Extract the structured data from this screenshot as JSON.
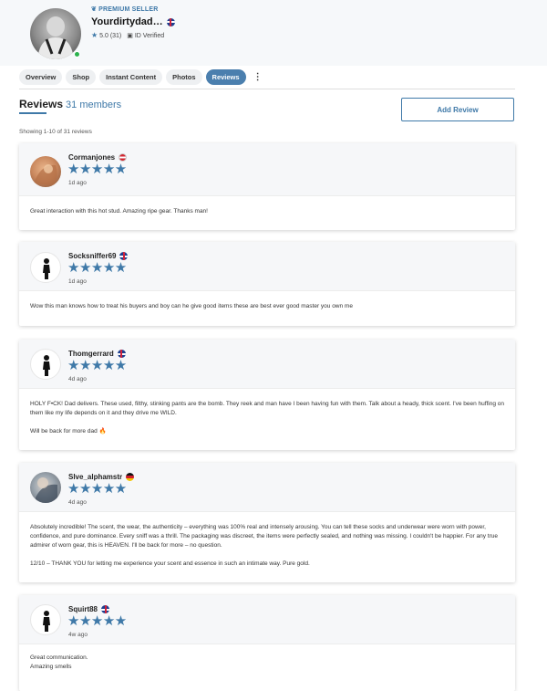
{
  "seller": {
    "badge": "PREMIUM SELLER",
    "name": "Yourdirtydad…",
    "rating": "5.0",
    "rating_count": "(31)",
    "verified": "ID Verified",
    "flag": "uk"
  },
  "tabs": [
    {
      "label": "Overview",
      "active": false
    },
    {
      "label": "Shop",
      "active": false
    },
    {
      "label": "Instant Content",
      "active": false
    },
    {
      "label": "Photos",
      "active": false
    },
    {
      "label": "Reviews",
      "active": true
    }
  ],
  "more_icon": "⋮",
  "reviews_header": {
    "title": "Reviews",
    "count": "31 members",
    "add_button": "Add Review",
    "showing": "Showing 1-10 of 31 reviews"
  },
  "reviews": [
    {
      "name": "Cormanjones",
      "flag": "at",
      "avatar": "photo",
      "stars": "★★★★★",
      "ago": "1d ago",
      "paragraphs": [
        "Great interaction with this hot stud. Amazing ripe gear. Thanks man!"
      ]
    },
    {
      "name": "Socksniffer69",
      "flag": "uk",
      "avatar": "silhouette",
      "stars": "★★★★★",
      "ago": "1d ago",
      "paragraphs": [
        "Wow this man knows how to treat his buyers and boy can he give good items these are best ever good master you own me"
      ]
    },
    {
      "name": "Thomgerrard",
      "flag": "uk",
      "avatar": "silhouette",
      "stars": "★★★★★",
      "ago": "4d ago",
      "paragraphs": [
        "HOLY F•CK! Dad delivers. These used, filthy, stinking pants are the bomb. They reek and man have I been having fun with them. Talk about a heady, thick scent. I've been huffing on them like my life depends on it and they drive me WILD.",
        "Will be back for more dad 🔥"
      ]
    },
    {
      "name": "Slve_alphamstr",
      "flag": "de",
      "avatar": "photo",
      "stars": "★★★★★",
      "ago": "4d ago",
      "paragraphs": [
        "Absolutely incredible! The scent, the wear, the authenticity – everything was 100% real and intensely arousing. You can tell these socks and underwear were worn with power, confidence, and pure dominance. Every sniff was a thrill. The packaging was discreet, the items were perfectly sealed, and nothing was missing. I couldn't be happier. For any true admirer of worn gear, this is HEAVEN. I'll be back for more – no question.",
        "12/10 – THANK YOU for letting me experience your scent and essence in such an intimate way. Pure gold."
      ]
    },
    {
      "name": "Squirt88",
      "flag": "uk",
      "avatar": "silhouette",
      "stars": "★★★★★",
      "ago": "4w ago",
      "paragraphs": [
        "Great communication.",
        "Amazing smells"
      ]
    }
  ]
}
